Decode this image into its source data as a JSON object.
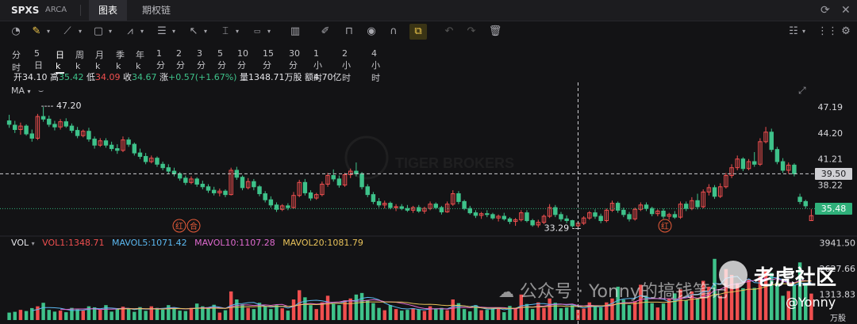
{
  "header": {
    "symbol": "SPXS",
    "exchange": "ARCA",
    "tabs": [
      {
        "label": "图表",
        "active": true
      },
      {
        "label": "期权链",
        "active": false
      }
    ]
  },
  "periods": [
    "分时",
    "5日",
    "日k",
    "周k",
    "月k",
    "季k",
    "年k",
    "1分",
    "2分",
    "3分",
    "5分",
    "10分",
    "15分",
    "30分",
    "1小时",
    "2小时",
    "4小时"
  ],
  "active_period": "日k",
  "quote": {
    "open_label": "开",
    "open": "34.10",
    "high_label": "高",
    "high": "35.42",
    "low_label": "低",
    "low": "34.09",
    "close_label": "收",
    "close": "34.67",
    "change_label": "涨",
    "change": "+0.57(+1.67%)",
    "volume_label": "量",
    "volume": "1348.71万股",
    "amount_label": "额",
    "amount": "4.70亿"
  },
  "ma_label": "MA",
  "volume_legend": {
    "label": "VOL",
    "vol1": "VOL1:1348.71",
    "mavol5": "MAVOL5:1071.42",
    "mavol10": "MAVOL10:1107.28",
    "mavol20": "MAVOL20:1081.79"
  },
  "price_axis": [
    "47.19",
    "44.20",
    "41.21",
    "38.22",
    "35.48"
  ],
  "price_tags": {
    "crosshair": "39.50",
    "last": "35.48"
  },
  "price_annotations": {
    "high": "47.20",
    "low": "33.29"
  },
  "volume_axis": [
    "3941.50",
    "2627.66",
    "1313.83"
  ],
  "volume_unit": "万股",
  "signals": [
    {
      "text": "红"
    },
    {
      "text": "合"
    },
    {
      "text": "红"
    }
  ],
  "watermark": {
    "brand": "TIGER BROKERS",
    "wechat": "公众号 · Yonny的搞钱笔记",
    "logo_text": "老虎社区",
    "handle": "@Yonny"
  },
  "colors": {
    "up": "#f04f4f",
    "down": "#3ec28a",
    "background": "#131315",
    "ma5": "#5bb8f0",
    "ma10": "#e06ad0",
    "ma20": "#e8c25a"
  },
  "chart_data": {
    "type": "candlestick",
    "y_range": [
      32.5,
      48.3
    ],
    "volume_range": [
      0,
      4000
    ],
    "ohlc": [
      [
        45.6,
        46.3,
        44.8,
        45.2
      ],
      [
        45.1,
        45.6,
        44.2,
        44.6
      ],
      [
        44.6,
        45.4,
        44.0,
        45.0
      ],
      [
        45.0,
        45.2,
        43.9,
        44.1
      ],
      [
        44.1,
        44.6,
        43.2,
        43.6
      ],
      [
        43.6,
        46.4,
        43.4,
        46.1
      ],
      [
        46.1,
        47.2,
        45.5,
        45.8
      ],
      [
        45.8,
        46.2,
        44.9,
        45.2
      ],
      [
        45.2,
        45.6,
        44.5,
        44.9
      ],
      [
        44.9,
        45.8,
        44.6,
        45.5
      ],
      [
        45.5,
        45.9,
        44.8,
        45.0
      ],
      [
        45.0,
        45.3,
        44.2,
        44.5
      ],
      [
        44.5,
        44.9,
        43.6,
        43.9
      ],
      [
        43.9,
        44.6,
        43.7,
        44.4
      ],
      [
        44.4,
        44.8,
        43.2,
        43.5
      ],
      [
        43.5,
        43.8,
        42.4,
        42.8
      ],
      [
        42.8,
        43.6,
        42.6,
        43.3
      ],
      [
        43.3,
        43.6,
        42.5,
        42.8
      ],
      [
        42.8,
        43.2,
        42.1,
        42.4
      ],
      [
        42.4,
        42.9,
        41.8,
        42.2
      ],
      [
        42.2,
        43.8,
        42.0,
        43.4
      ],
      [
        43.4,
        43.7,
        42.6,
        42.9
      ],
      [
        42.9,
        43.1,
        41.6,
        41.9
      ],
      [
        41.9,
        42.4,
        41.2,
        41.5
      ],
      [
        41.5,
        41.9,
        40.6,
        40.9
      ],
      [
        40.9,
        41.6,
        40.7,
        41.3
      ],
      [
        41.3,
        41.5,
        40.3,
        40.6
      ],
      [
        40.6,
        40.9,
        39.9,
        40.2
      ],
      [
        40.2,
        40.6,
        39.5,
        39.8
      ],
      [
        39.8,
        40.2,
        39.2,
        39.5
      ],
      [
        39.5,
        39.7,
        38.7,
        39.0
      ],
      [
        39.0,
        39.3,
        38.2,
        38.5
      ],
      [
        38.5,
        39.2,
        38.3,
        38.9
      ],
      [
        38.9,
        39.1,
        38.0,
        38.3
      ],
      [
        38.3,
        38.7,
        37.7,
        38.0
      ],
      [
        38.0,
        38.3,
        37.3,
        37.6
      ],
      [
        37.6,
        38.0,
        37.0,
        37.3
      ],
      [
        37.3,
        37.8,
        36.9,
        37.5
      ],
      [
        37.5,
        37.7,
        36.8,
        37.1
      ],
      [
        37.1,
        40.2,
        37.0,
        39.9
      ],
      [
        39.9,
        40.3,
        38.8,
        39.1
      ],
      [
        39.1,
        39.3,
        37.6,
        37.9
      ],
      [
        37.9,
        39.0,
        37.7,
        38.6
      ],
      [
        38.6,
        38.9,
        37.6,
        38.0
      ],
      [
        38.0,
        38.2,
        36.9,
        37.2
      ],
      [
        37.2,
        37.5,
        36.2,
        36.5
      ],
      [
        36.5,
        36.9,
        35.6,
        35.9
      ],
      [
        35.9,
        36.2,
        35.1,
        35.4
      ],
      [
        35.4,
        36.0,
        35.2,
        35.8
      ],
      [
        35.8,
        36.1,
        35.3,
        35.6
      ],
      [
        35.6,
        37.4,
        35.5,
        37.0
      ],
      [
        37.0,
        38.8,
        36.8,
        38.5
      ],
      [
        38.5,
        38.9,
        37.0,
        37.3
      ],
      [
        37.3,
        37.6,
        36.4,
        36.7
      ],
      [
        36.7,
        37.3,
        36.5,
        37.1
      ],
      [
        37.1,
        38.6,
        36.9,
        38.3
      ],
      [
        38.3,
        39.6,
        38.0,
        39.3
      ],
      [
        39.3,
        40.0,
        38.6,
        38.9
      ],
      [
        38.9,
        39.3,
        37.9,
        38.2
      ],
      [
        38.2,
        39.6,
        38.0,
        39.4
      ],
      [
        39.4,
        40.1,
        39.0,
        39.8
      ],
      [
        39.8,
        40.8,
        39.2,
        39.5
      ],
      [
        39.5,
        39.7,
        37.7,
        38.0
      ],
      [
        38.0,
        38.3,
        36.8,
        37.1
      ],
      [
        37.1,
        37.4,
        36.0,
        36.3
      ],
      [
        36.3,
        36.7,
        35.6,
        35.9
      ],
      [
        35.9,
        36.4,
        35.5,
        36.1
      ],
      [
        36.1,
        36.3,
        35.4,
        35.6
      ],
      [
        35.6,
        36.0,
        35.2,
        35.7
      ],
      [
        35.7,
        36.0,
        35.3,
        35.5
      ],
      [
        35.5,
        35.9,
        35.1,
        35.3
      ],
      [
        35.3,
        35.8,
        35.0,
        35.6
      ],
      [
        35.6,
        35.9,
        35.0,
        35.2
      ],
      [
        35.2,
        35.7,
        34.9,
        35.5
      ],
      [
        35.5,
        36.3,
        35.3,
        36.0
      ],
      [
        36.0,
        36.2,
        35.4,
        35.6
      ],
      [
        35.6,
        35.8,
        34.8,
        35.1
      ],
      [
        35.1,
        36.3,
        35.0,
        36.0
      ],
      [
        36.0,
        37.6,
        35.8,
        37.2
      ],
      [
        37.2,
        37.5,
        36.0,
        36.3
      ],
      [
        36.3,
        36.5,
        35.3,
        35.5
      ],
      [
        35.5,
        35.8,
        34.8,
        35.0
      ],
      [
        35.0,
        35.3,
        34.4,
        34.7
      ],
      [
        34.7,
        35.1,
        34.3,
        34.9
      ],
      [
        34.9,
        35.3,
        34.5,
        34.8
      ],
      [
        34.8,
        35.0,
        34.2,
        34.4
      ],
      [
        34.4,
        34.8,
        34.0,
        34.6
      ],
      [
        34.6,
        35.0,
        34.1,
        34.3
      ],
      [
        34.3,
        34.5,
        33.7,
        34.0
      ],
      [
        34.0,
        34.4,
        33.5,
        34.2
      ],
      [
        34.2,
        35.3,
        34.0,
        35.0
      ],
      [
        35.0,
        35.3,
        33.9,
        34.1
      ],
      [
        34.1,
        34.3,
        33.4,
        33.6
      ],
      [
        33.6,
        34.2,
        33.3,
        33.9
      ],
      [
        33.9,
        34.8,
        33.7,
        34.6
      ],
      [
        34.6,
        36.0,
        34.4,
        35.6
      ],
      [
        35.6,
        35.9,
        34.5,
        34.8
      ],
      [
        34.8,
        35.1,
        34.0,
        34.3
      ],
      [
        34.3,
        34.7,
        33.8,
        34.1
      ],
      [
        34.1,
        34.2,
        33.3,
        33.5
      ],
      [
        33.5,
        34.0,
        33.29,
        33.8
      ],
      [
        33.8,
        34.6,
        33.6,
        34.4
      ],
      [
        34.4,
        35.2,
        34.2,
        35.0
      ],
      [
        35.0,
        35.4,
        34.3,
        34.6
      ],
      [
        34.6,
        34.9,
        33.8,
        34.1
      ],
      [
        34.1,
        35.5,
        33.9,
        35.3
      ],
      [
        35.3,
        36.4,
        35.1,
        36.1
      ],
      [
        36.1,
        36.3,
        35.0,
        35.3
      ],
      [
        35.3,
        35.6,
        34.5,
        34.8
      ],
      [
        34.8,
        35.1,
        34.0,
        34.3
      ],
      [
        34.3,
        35.6,
        34.1,
        35.4
      ],
      [
        35.4,
        36.2,
        35.2,
        35.9
      ],
      [
        35.9,
        36.2,
        35.2,
        35.5
      ],
      [
        35.5,
        35.7,
        34.6,
        34.9
      ],
      [
        34.9,
        35.4,
        34.6,
        35.2
      ],
      [
        35.2,
        35.5,
        34.3,
        34.6
      ],
      [
        34.6,
        35.0,
        34.2,
        34.8
      ],
      [
        34.8,
        35.2,
        34.3,
        34.5
      ],
      [
        34.5,
        36.3,
        34.3,
        36.0
      ],
      [
        36.0,
        36.3,
        35.2,
        35.5
      ],
      [
        35.5,
        36.8,
        35.3,
        36.4
      ],
      [
        36.4,
        37.2,
        35.4,
        35.7
      ],
      [
        35.7,
        37.7,
        35.5,
        37.4
      ],
      [
        37.4,
        38.3,
        37.0,
        37.9
      ],
      [
        37.9,
        38.2,
        36.6,
        36.9
      ],
      [
        36.9,
        38.4,
        36.7,
        38.0
      ],
      [
        38.0,
        39.6,
        37.8,
        39.3
      ],
      [
        39.3,
        40.6,
        39.0,
        40.2
      ],
      [
        40.2,
        41.6,
        39.9,
        41.2
      ],
      [
        41.2,
        41.4,
        39.8,
        40.1
      ],
      [
        40.1,
        41.2,
        39.9,
        40.9
      ],
      [
        40.9,
        42.0,
        40.3,
        40.6
      ],
      [
        40.6,
        43.6,
        40.4,
        43.2
      ],
      [
        43.2,
        44.9,
        43.0,
        44.3
      ],
      [
        44.3,
        44.7,
        42.0,
        42.3
      ],
      [
        42.3,
        42.6,
        40.6,
        40.9
      ],
      [
        40.9,
        41.3,
        39.6,
        39.9
      ],
      [
        39.9,
        40.8,
        39.5,
        40.5
      ],
      [
        40.5,
        40.7,
        39.2,
        39.5
      ],
      [
        36.8,
        37.2,
        36.0,
        36.3
      ],
      [
        36.3,
        36.5,
        35.5,
        35.8
      ],
      [
        34.1,
        35.42,
        34.09,
        34.67
      ]
    ],
    "volume": [
      380,
      420,
      520,
      460,
      610,
      700,
      880,
      520,
      430,
      480,
      400,
      620,
      540,
      480,
      700,
      650,
      520,
      760,
      430,
      560,
      680,
      560,
      420,
      660,
      470,
      700,
      620,
      530,
      760,
      600,
      480,
      460,
      620,
      840,
      700,
      600,
      780,
      380,
      500,
      1460,
      1050,
      800,
      620,
      560,
      880,
      680,
      560,
      760,
      600,
      480,
      1050,
      1520,
      1160,
      760,
      560,
      900,
      1240,
      820,
      760,
      1000,
      1100,
      1300,
      1380,
      1000,
      860,
      620,
      500,
      760,
      560,
      480,
      520,
      600,
      540,
      460,
      700,
      560,
      620,
      500,
      1050,
      860,
      560,
      440,
      760,
      500,
      520,
      580,
      620,
      400,
      720,
      600,
      1300,
      820,
      560,
      900,
      620,
      1100,
      880,
      600,
      640,
      760,
      520,
      580,
      900,
      700,
      640,
      900,
      1100,
      1700,
      1040,
      760,
      960,
      1800,
      1200,
      860,
      640,
      840,
      1100,
      1360,
      1560,
      1000,
      1460,
      1100,
      2000,
      1700,
      3120,
      1240,
      2600,
      2300,
      1880,
      1620,
      2100,
      1640,
      2220,
      2540,
      2400,
      1900,
      1240,
      1480,
      1820,
      2940,
      1900,
      1348.71
    ]
  }
}
